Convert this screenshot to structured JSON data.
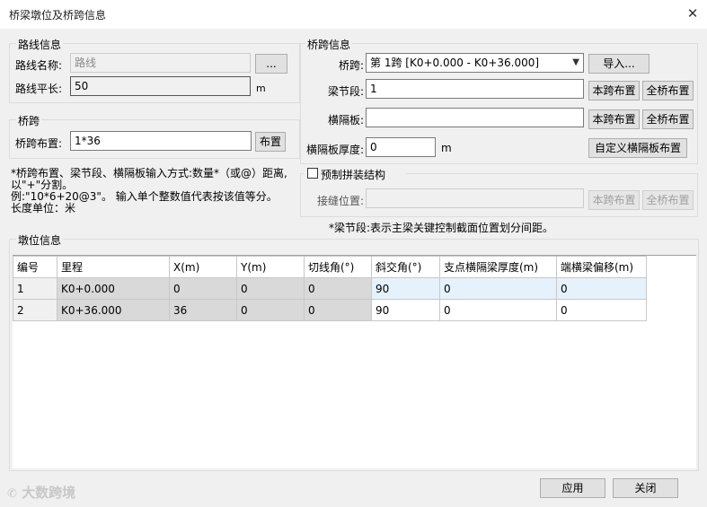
{
  "window": {
    "title": "桥梁墩位及桥跨信息",
    "close": "✕"
  },
  "route": {
    "group_label": "路线信息",
    "name_label": "路线名称:",
    "name_value": "路线",
    "browse": "...",
    "length_label": "路线平长:",
    "length_value": "50",
    "length_unit": "m"
  },
  "span": {
    "group_label": "桥跨",
    "layout_label": "桥跨布置:",
    "layout_value": "1*36",
    "layout_button": "布置"
  },
  "note": {
    "line1": "*桥跨布置、梁节段、横隔板输入方式:数量*（或@）距离,",
    "line2": "以\"+\"分割。",
    "line3": "例:\"10*6+20@3\"。 输入单个整数值代表按该值等分。",
    "line4": "长度单位：米"
  },
  "bridge": {
    "group_label": "桥跨信息",
    "span_label": "桥跨:",
    "span_value": "第  1跨 [K0+0.000  -  K0+36.000]",
    "import": "导入...",
    "segment_label": "梁节段:",
    "segment_value": "1",
    "diaphragm_label": "横隔板:",
    "diaphragm_value": "",
    "thickness_label": "横隔板厚度:",
    "thickness_value": "0",
    "thickness_unit": "m",
    "this_span": "本跨布置",
    "whole_bridge": "全桥布置",
    "custom_diaphragm": "自定义横隔板布置"
  },
  "precast": {
    "checkbox_label": "预制拼装结构",
    "joint_label": "接缝位置:",
    "joint_value": "",
    "this_span": "本跨布置",
    "whole_bridge": "全桥布置"
  },
  "segment_note": "*梁节段:表示主梁关键控制截面位置划分间距。",
  "pier": {
    "group_label": "墩位信息",
    "columns": [
      "编号",
      "里程",
      "X(m)",
      "Y(m)",
      "切线角(°)",
      "斜交角(°)",
      "支点横隔梁厚度(m)",
      "端横梁偏移(m)"
    ],
    "rows": [
      [
        "1",
        "K0+0.000",
        "0",
        "0",
        "0",
        "90",
        "0",
        "0"
      ],
      [
        "2",
        "K0+36.000",
        "36",
        "0",
        "0",
        "90",
        "0",
        "0"
      ]
    ]
  },
  "footer": {
    "apply": "应用",
    "close": "关闭"
  },
  "watermark": "大数跨境"
}
